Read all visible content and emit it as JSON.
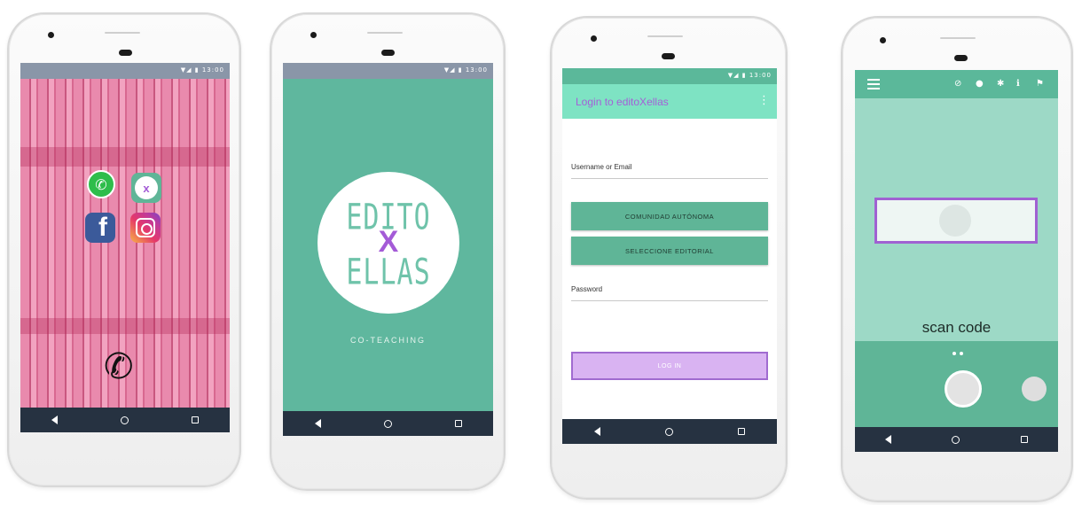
{
  "phone1": {
    "status_icons": "▼◢ ▮ 13:00",
    "apps": [
      "WhatsApp",
      "editoXellas",
      "Facebook",
      "Instagram"
    ],
    "fb_glyph": "f",
    "x_glyph": "x",
    "call_glyph": "✆"
  },
  "phone2": {
    "status_icons": "▼◢ ▮ 13:00",
    "logo_top": "EDITO",
    "logo_x": "X",
    "logo_bottom": "ELLAS",
    "tagline": "CO-TEACHING"
  },
  "phone3": {
    "status_icons": "▼◢ ▮ 13:00",
    "appbar_title": "Login to  editoXellas",
    "menu_glyph": "⋮",
    "username_label": "Username or Email",
    "community_button": "COMUNIDAD  AUTÓNOMA",
    "editorial_button": "SELECCIONE  EDITORIAL",
    "password_label": "Password",
    "login_button": "LOG IN"
  },
  "phone4": {
    "toolbar_icons": [
      "⊘",
      "●",
      "✱",
      "ℹ",
      "⚑"
    ],
    "scan_label": "scan code"
  },
  "colors": {
    "primary_green": "#5fb597",
    "accent_purple": "#a55fd8",
    "navbar": "#263241"
  }
}
